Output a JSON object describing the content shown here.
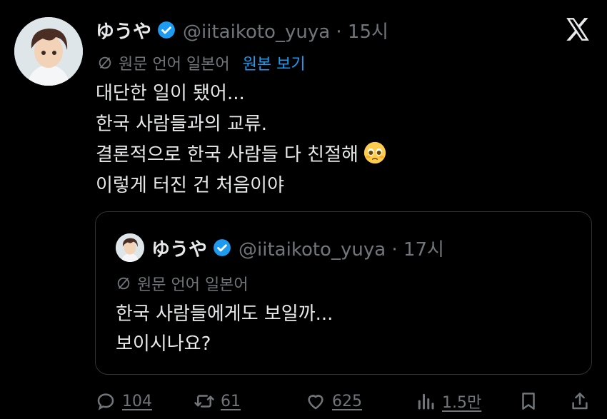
{
  "tweet": {
    "author_name": "ゆうや",
    "handle_time": "@iitaikoto_yuya · 15시",
    "translation_label": "원문 언어 일본어",
    "view_original": "원본 보기",
    "lines": [
      "대단한 일이 됐어...",
      "한국 사람들과의 교류.",
      "결론적으로 한국 사람들 다 친절해",
      "이렇게 터진 건 처음이야"
    ]
  },
  "quote": {
    "author_name": "ゆうや",
    "handle_time": "@iitaikoto_yuya · 17시",
    "translation_label": "원문 언어 일본어",
    "lines": [
      "한국 사람들에게도 보일까...",
      "보이시나요?"
    ]
  },
  "actions": {
    "replies": "104",
    "retweets": "61",
    "likes": "625",
    "views": "1.5만"
  },
  "colors": {
    "accent": "#1d9bf0",
    "muted": "#71767b",
    "text": "#e7e9ea",
    "background": "#000000"
  }
}
